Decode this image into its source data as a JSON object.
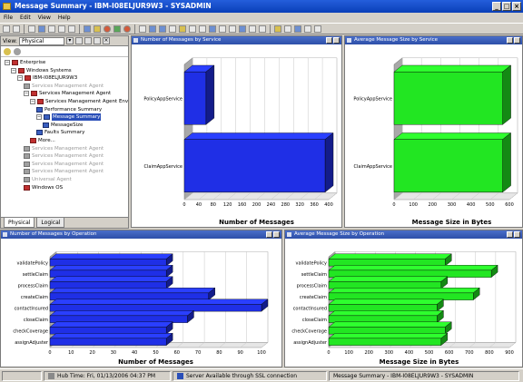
{
  "window": {
    "title": "Message Summary - IBM-I08ELJUR9W3 - SYSADMIN"
  },
  "menu": [
    "File",
    "Edit",
    "View",
    "Help"
  ],
  "navigator": {
    "view_label": "View:",
    "view_value": "Physical",
    "tree": [
      {
        "label": "Enterprise",
        "level": 0,
        "icon": "enterprise-icon",
        "dim": false,
        "selected": false
      },
      {
        "label": "Windows Systems",
        "level": 1,
        "icon": "windows-systems-icon",
        "dim": false,
        "selected": false
      },
      {
        "label": "IBM-I08ELJUR9W3",
        "level": 2,
        "icon": "computer-icon",
        "dim": false,
        "selected": false
      },
      {
        "label": "Services Management Agent",
        "level": 3,
        "icon": "agent-icon",
        "dim": true,
        "selected": false
      },
      {
        "label": "Services Management Agent",
        "level": 3,
        "icon": "agent-icon",
        "dim": false,
        "selected": false
      },
      {
        "label": "Services Management Agent Env",
        "level": 4,
        "icon": "agent-icon",
        "dim": false,
        "selected": false
      },
      {
        "label": "Performance Summary",
        "level": 5,
        "icon": "workspace-icon",
        "dim": false,
        "selected": false
      },
      {
        "label": "Message Summary",
        "level": 5,
        "icon": "workspace-icon",
        "dim": false,
        "selected": true
      },
      {
        "label": "MessageSize",
        "level": 6,
        "icon": "workspace-icon",
        "dim": false,
        "selected": false
      },
      {
        "label": "Faults Summary",
        "level": 5,
        "icon": "workspace-icon",
        "dim": false,
        "selected": false
      },
      {
        "label": "More...",
        "level": 4,
        "icon": "more-icon",
        "dim": false,
        "selected": false
      },
      {
        "label": "Services Management Agent",
        "level": 3,
        "icon": "agent-icon",
        "dim": true,
        "selected": false
      },
      {
        "label": "Services Management Agent",
        "level": 3,
        "icon": "agent-icon",
        "dim": true,
        "selected": false
      },
      {
        "label": "Services Management Agent",
        "level": 3,
        "icon": "agent-icon",
        "dim": true,
        "selected": false
      },
      {
        "label": "Services Management Agent",
        "level": 3,
        "icon": "agent-icon",
        "dim": true,
        "selected": false
      },
      {
        "label": "Universal Agent",
        "level": 3,
        "icon": "agent-icon",
        "dim": true,
        "selected": false
      },
      {
        "label": "Windows OS",
        "level": 3,
        "icon": "os-icon",
        "dim": false,
        "selected": false
      }
    ],
    "tabs": [
      "Physical",
      "Logical"
    ]
  },
  "panels": {
    "tl": {
      "title": "Number of Messages by Service"
    },
    "tr": {
      "title": "Average Message Size by Service"
    },
    "bl": {
      "title": "Number of Messages by Operation"
    },
    "br": {
      "title": "Average Message Size by Operation"
    }
  },
  "chart_data": [
    {
      "type": "bar",
      "orientation": "horizontal",
      "title": "Number of Messages by Service",
      "categories": [
        "PolicyAppService",
        "ClaimAppService"
      ],
      "values": [
        60,
        390
      ],
      "xlabel": "Number of Messages",
      "xlim": [
        0,
        400
      ],
      "ticks": [
        "0",
        "40",
        "80",
        "120",
        "160",
        "200",
        "240",
        "280",
        "320",
        "360",
        "400"
      ],
      "color": "#1f2fe6"
    },
    {
      "type": "bar",
      "orientation": "horizontal",
      "title": "Average Message Size by Service",
      "categories": [
        "PolicyAppService",
        "ClaimAppService"
      ],
      "values": [
        565,
        565
      ],
      "xlabel": "Message Size in Bytes",
      "xlim": [
        0,
        600
      ],
      "ticks": [
        "0",
        "100",
        "200",
        "300",
        "400",
        "500",
        "600"
      ],
      "color": "#22e622"
    },
    {
      "type": "bar",
      "orientation": "horizontal",
      "title": "Number of Messages by Operation",
      "categories": [
        "validatePolicy",
        "settleClaim",
        "processClaim",
        "createClaim",
        "contactInsured",
        "closeClaim",
        "checkCoverage",
        "assignAdjuster"
      ],
      "values": [
        55,
        55,
        55,
        75,
        100,
        65,
        55,
        55
      ],
      "xlabel": "Number of Messages",
      "xlim": [
        0,
        100
      ],
      "ticks": [
        "0",
        "10",
        "20",
        "30",
        "40",
        "50",
        "60",
        "70",
        "80",
        "90",
        "100"
      ],
      "color": "#1f2fe6"
    },
    {
      "type": "bar",
      "orientation": "horizontal",
      "title": "Average Message Size by Operation",
      "categories": [
        "validatePolicy",
        "settleClaim",
        "processClaim",
        "createClaim",
        "contactInsured",
        "closeClaim",
        "checkCoverage",
        "assignAdjuster"
      ],
      "values": [
        580,
        810,
        560,
        720,
        540,
        540,
        580,
        560
      ],
      "xlabel": "Message Size in Bytes",
      "xlim": [
        0,
        900
      ],
      "ticks": [
        "0",
        "100",
        "200",
        "300",
        "400",
        "500",
        "600",
        "700",
        "800",
        "900"
      ],
      "color": "#22e622"
    }
  ],
  "status": {
    "hub_time": "Hub Time: Fri, 01/13/2006 04:37 PM",
    "connection": "Server Available through SSL connection",
    "workspace": "Message Summary - IBM-I08ELJUR9W3 - SYSADMIN"
  }
}
